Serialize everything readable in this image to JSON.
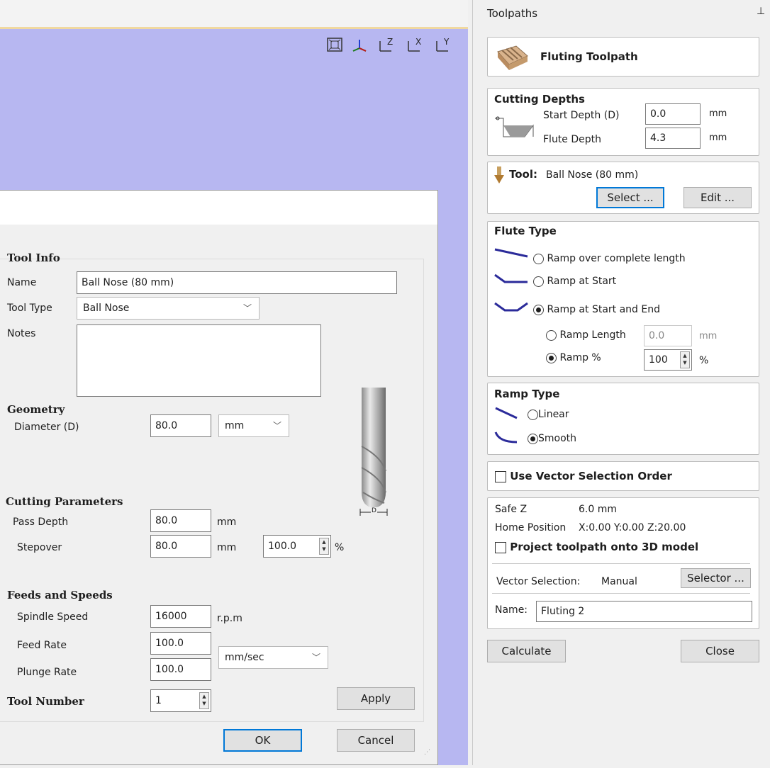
{
  "viewport": {
    "axis_icons": [
      "fit-view-icon",
      "iso-view-icon",
      "top-view-icon",
      "front-view-icon",
      "side-view-icon"
    ],
    "axis_labels": [
      "Z",
      "X",
      "Y"
    ]
  },
  "dialog": {
    "tool_info_heading": "Tool Info",
    "name_label": "Name",
    "name_value": "Ball Nose (80 mm)",
    "tool_type_label": "Tool Type",
    "tool_type_value": "Ball Nose",
    "notes_label": "Notes",
    "geometry_heading": "Geometry",
    "diameter_label": "Diameter (D)",
    "diameter_value": "80.0",
    "diameter_unit": "mm",
    "cutting_params_heading": "Cutting Parameters",
    "pass_depth_label": "Pass Depth",
    "pass_depth_value": "80.0",
    "pass_depth_unit": "mm",
    "stepover_label": "Stepover",
    "stepover_value": "80.0",
    "stepover_unit": "mm",
    "stepover_percent": "100.0",
    "percent_sign": "%",
    "feeds_heading": "Feeds and Speeds",
    "spindle_label": "Spindle Speed",
    "spindle_value": "16000",
    "spindle_unit": "r.p.m",
    "feed_label": "Feed Rate",
    "feed_value": "100.0",
    "plunge_label": "Plunge Rate",
    "plunge_value": "100.0",
    "rate_unit": "mm/sec",
    "tool_number_label": "Tool Number",
    "tool_number_value": "1",
    "apply_label": "Apply",
    "ok_label": "OK",
    "cancel_label": "Cancel",
    "diagram_label": "D"
  },
  "panel": {
    "title": "Toolpaths",
    "pin_icon": "pin-icon",
    "header": "Fluting Toolpath",
    "cutting_depths": {
      "heading": "Cutting Depths",
      "start_label": "Start Depth (D)",
      "start_value": "0.0",
      "flute_label": "Flute Depth",
      "flute_value": "4.3",
      "unit": "mm"
    },
    "tool": {
      "label": "Tool:",
      "value": "Ball Nose (80 mm)",
      "select_label": "Select ...",
      "edit_label": "Edit ..."
    },
    "flute_type": {
      "heading": "Flute Type",
      "opt1": "Ramp over complete length",
      "opt2": "Ramp at Start",
      "opt3": "Ramp at Start and End",
      "ramp_length_label": "Ramp Length",
      "ramp_length_value": "0.0",
      "ramp_length_unit": "mm",
      "ramp_pct_label": "Ramp %",
      "ramp_pct_value": "100",
      "ramp_pct_unit": "%"
    },
    "ramp_type": {
      "heading": "Ramp Type",
      "linear": "Linear",
      "smooth": "Smooth"
    },
    "use_vector_order": "Use Vector Selection Order",
    "safe_z_label": "Safe Z",
    "safe_z_value": "6.0 mm",
    "home_label": "Home Position",
    "home_value": "X:0.00 Y:0.00 Z:20.00",
    "project_label": "Project toolpath onto 3D model",
    "vector_sel_label": "Vector Selection:",
    "vector_sel_value": "Manual",
    "selector_label": "Selector ...",
    "name_label": "Name:",
    "name_value": "Fluting 2",
    "calculate_label": "Calculate",
    "close_label": "Close"
  }
}
